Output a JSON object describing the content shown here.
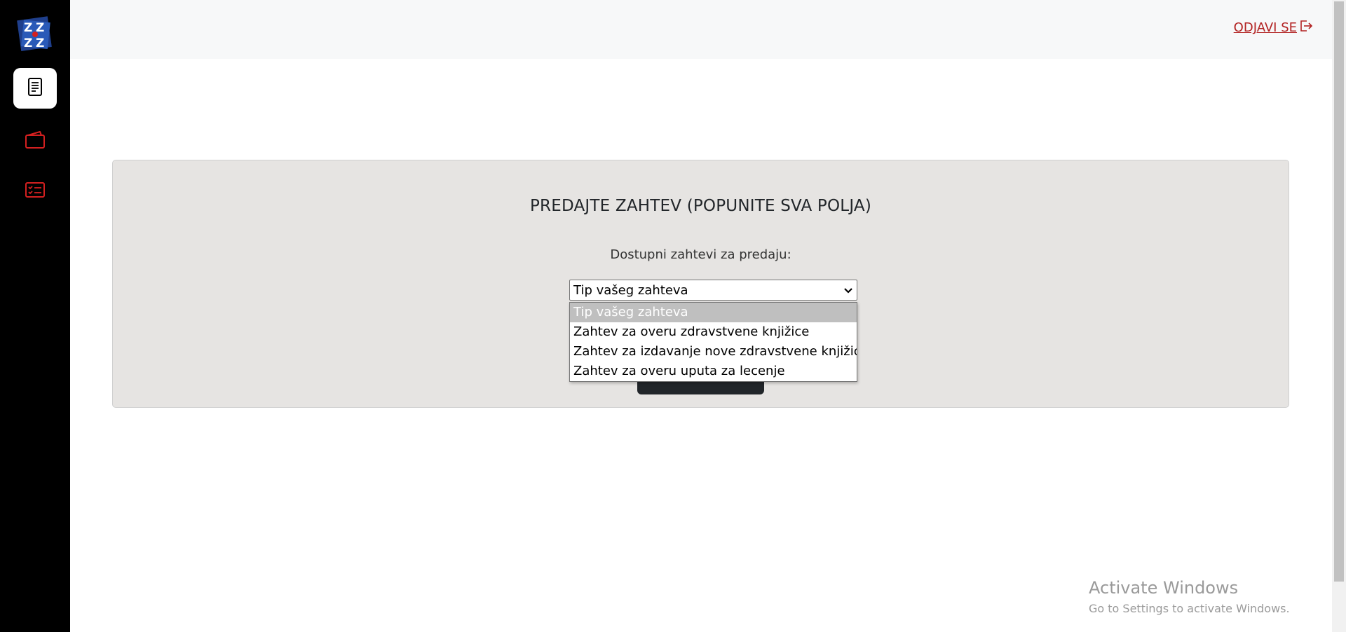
{
  "sidebar": {
    "logo_text": "ZZZ",
    "items": [
      {
        "icon": "document-icon",
        "active": true
      },
      {
        "icon": "wallet-icon",
        "active": false
      },
      {
        "icon": "checklist-icon",
        "active": false
      }
    ]
  },
  "header": {
    "logout_label": "ODJAVI SE",
    "logout_icon": "logout-icon"
  },
  "form": {
    "title": "PREDAJTE ZAHTEV (POPUNITE SVA POLJA)",
    "subtitle": "Dostupni zahtevi za predaju:",
    "select_value": "Tip vašeg zahteva",
    "options": [
      "Tip vašeg zahteva",
      "Zahtev za overu zdravstvene knjižice",
      "Zahtev za izdavanje nove zdravstvene knjižice",
      "Zahtev za overu uputa za lecenje"
    ],
    "selected_index": 0
  },
  "watermark": {
    "title": "Activate Windows",
    "subtitle": "Go to Settings to activate Windows."
  },
  "colors": {
    "accent_red": "#b22222",
    "sidebar_bg": "#000000",
    "panel_bg": "#e6e4e2",
    "button_dark": "#212529"
  }
}
